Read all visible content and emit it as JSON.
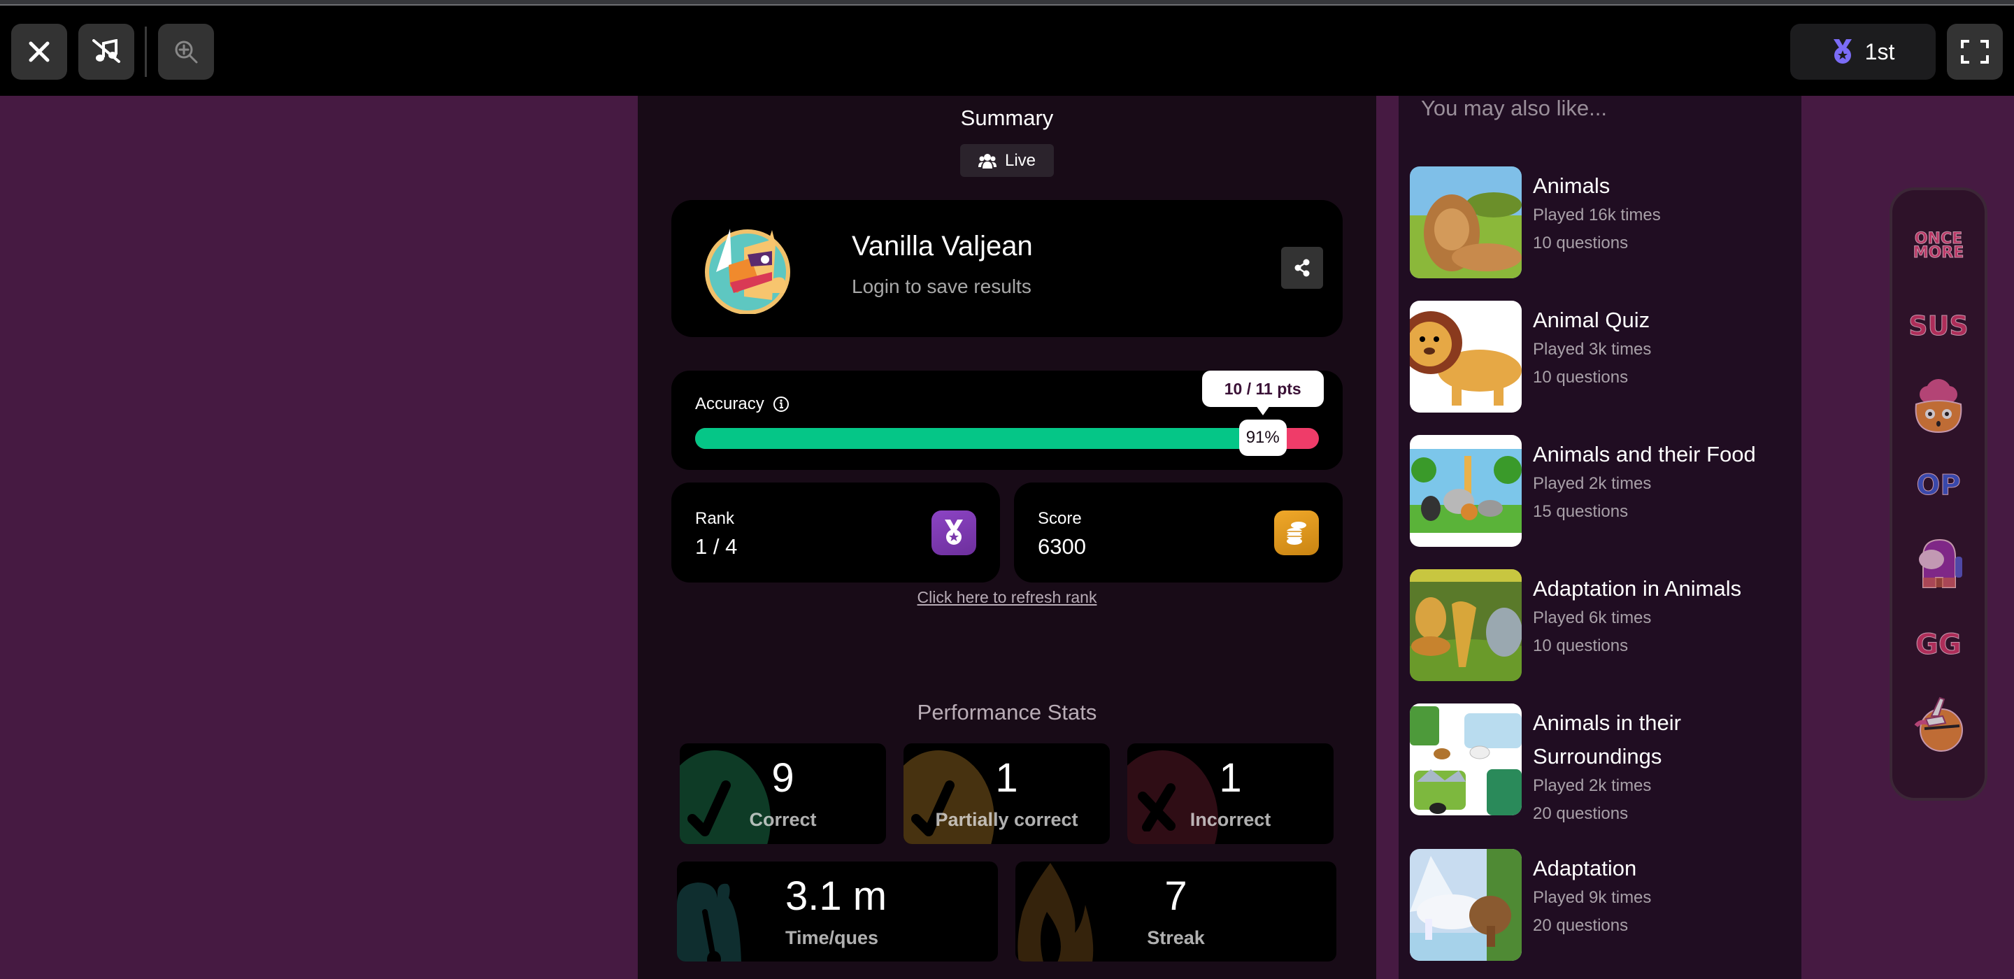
{
  "topbar": {
    "close_icon": "close-icon",
    "music_icon": "music-off-icon",
    "zoom_icon": "zoom-in-icon",
    "rank_badge": {
      "icon": "medal-icon",
      "label": "1st",
      "color": "#7b6cf6"
    },
    "fullscreen_icon": "fullscreen-icon"
  },
  "summary": {
    "title": "Summary",
    "mode_badge": {
      "icon": "users-icon",
      "label": "Live"
    }
  },
  "profile": {
    "name": "Vanilla Valjean",
    "subtitle": "Login to save results",
    "share_icon": "share-icon"
  },
  "accuracy": {
    "label": "Accuracy",
    "info_icon": "info-icon",
    "percent": 91,
    "percent_label": "91%",
    "points_label": "10 / 11 pts",
    "correct_color": "#05c687",
    "incorrect_color": "#ef3c69"
  },
  "rank": {
    "label": "Rank",
    "value": "1 / 4",
    "icon": "medal-icon",
    "icon_color": "#8a3fb8"
  },
  "score": {
    "label": "Score",
    "value": "6300",
    "icon": "coins-icon",
    "icon_color": "#e69b1c"
  },
  "refresh_link": "Click here to refresh rank",
  "performance": {
    "title": "Performance Stats",
    "stats": [
      {
        "value": "9",
        "label": "Correct",
        "icon": "check-icon",
        "color": "#0e3b26"
      },
      {
        "value": "1",
        "label": "Partially correct",
        "icon": "check-icon",
        "color": "#473210"
      },
      {
        "value": "1",
        "label": "Incorrect",
        "icon": "cross-icon",
        "color": "#2f0d15"
      },
      {
        "value": "3.1 m",
        "label": "Time/ques",
        "icon": "stopwatch-icon",
        "color": "#0f2e2f"
      },
      {
        "value": "7",
        "label": "Streak",
        "icon": "flame-icon",
        "color": "#35230c"
      }
    ]
  },
  "recommendations": {
    "title": "You may also like...",
    "items": [
      {
        "name": "Animals",
        "played": "Played 16k times",
        "questions": "10 questions"
      },
      {
        "name": "Animal Quiz",
        "played": "Played 3k times",
        "questions": "10 questions"
      },
      {
        "name": "Animals and their Food",
        "played": "Played 2k times",
        "questions": "15 questions"
      },
      {
        "name": "Adaptation in Animals",
        "played": "Played 6k times",
        "questions": "10 questions"
      },
      {
        "name": "Animals in their Surroundings",
        "played": "Played 2k times",
        "questions": "20 questions"
      },
      {
        "name": "Adaptation",
        "played": "Played 9k times",
        "questions": "20 questions"
      }
    ]
  },
  "stickers": [
    {
      "name": "once-more-sticker",
      "text": "ONCE MORE"
    },
    {
      "name": "sus-sticker",
      "text": "SUS"
    },
    {
      "name": "mind-blown-sticker",
      "text": ""
    },
    {
      "name": "op-sticker",
      "text": "OP"
    },
    {
      "name": "crewmate-sticker",
      "text": ""
    },
    {
      "name": "gg-sticker",
      "text": "GG"
    },
    {
      "name": "loser-sticker",
      "text": ""
    }
  ]
}
